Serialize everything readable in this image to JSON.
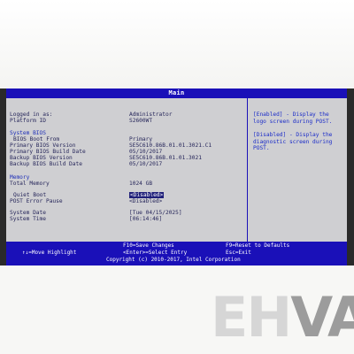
{
  "title": "Main",
  "left": {
    "logged_in_label": "Logged in as:",
    "logged_in_value": "Administrator",
    "platform_label": "Platform ID",
    "platform_value": "S2600WT",
    "system_bios_heading": "System BIOS",
    "boot_from_label": "BIOS Boot From",
    "boot_from_value": "Primary",
    "primary_version_label": "Primary BIOS Version",
    "primary_version_value": "SE5C610.86B.01.01.3021.C1",
    "primary_date_label": "Primary BIOS Build Date",
    "primary_date_value": "05/10/2017",
    "backup_version_label": "Backup BIOS Version",
    "backup_version_value": "SE5C610.86B.01.01.3021",
    "backup_date_label": "Backup BIOS Build Date",
    "backup_date_value": "05/10/2017",
    "memory_heading": "Memory",
    "total_memory_label": "Total Memory",
    "total_memory_value": "1024 GB",
    "quiet_boot_label": "Quiet Boot",
    "quiet_boot_value": "<Disabled>",
    "post_pause_label": "POST Error Pause",
    "post_pause_value": "<Disabled>",
    "system_date_label": "System Date",
    "system_date_value": "[Tue 04/15/2025]",
    "system_time_label": "System Time",
    "system_time_value": "[06:14:46]"
  },
  "help": {
    "enabled_text": "[Enabled] - Display the logo screen during POST.",
    "disabled_text": "[Disabled] - Display the diagnostic screen during POST."
  },
  "footer": {
    "f10": "F10=Save Changes",
    "f9": "F9=Reset to Defaults",
    "move": "↑↓=Move Highlight",
    "enter": "<Enter>=Select Entry",
    "esc": "Esc=Exit",
    "copyright": "Copyright (c) 2010-2017, Intel Corporation"
  },
  "watermark": "EHVA"
}
